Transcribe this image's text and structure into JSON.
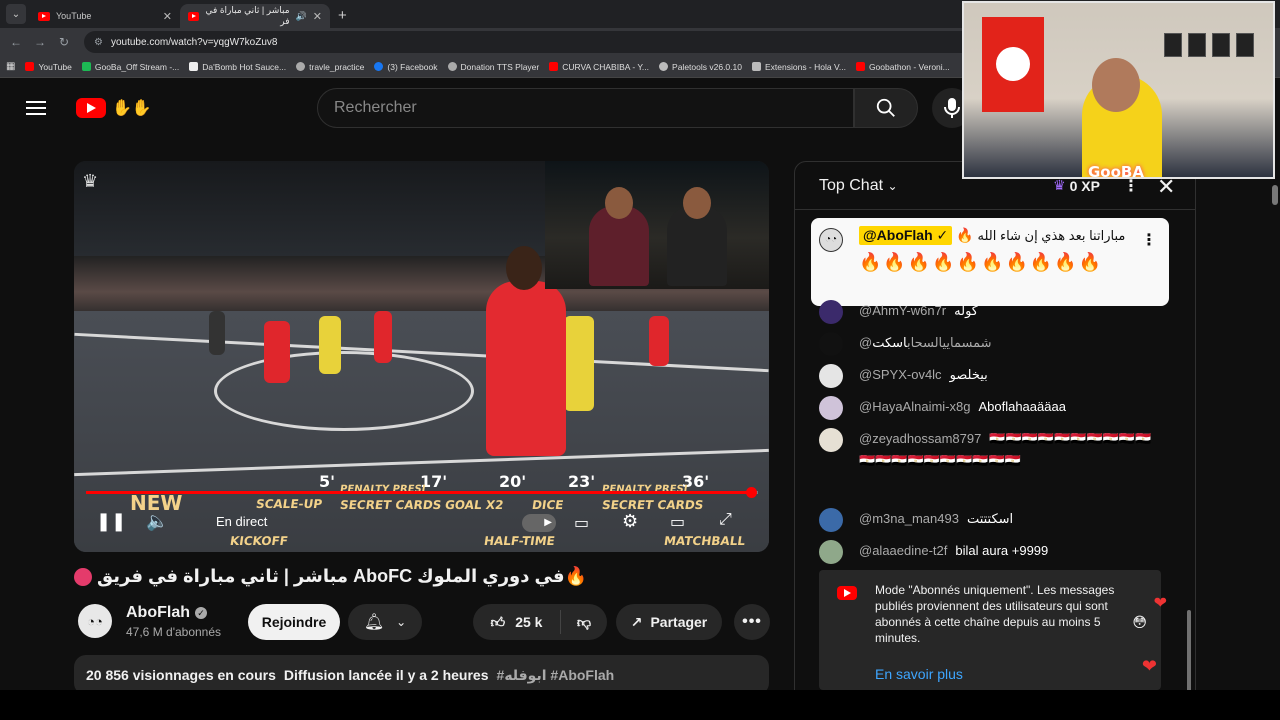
{
  "browser": {
    "tabs": [
      {
        "title": "YouTube",
        "active": false
      },
      {
        "title": "مباشر | ثاني مباراة في فر",
        "active": true
      }
    ],
    "url": "youtube.com/watch?v=yqgW7koZuv8",
    "bookmarks": [
      {
        "label": "YouTube",
        "color": "#ff0000"
      },
      {
        "label": "GooBa_Off Stream -...",
        "color": "#1db954"
      },
      {
        "label": "Da'Bomb Hot Sauce...",
        "color": "#eeeeee"
      },
      {
        "label": "travle_practice",
        "color": "#aaaaaa"
      },
      {
        "label": "(3) Facebook",
        "color": "#1877f2"
      },
      {
        "label": "Donation TTS Player",
        "color": "#aaaaaa"
      },
      {
        "label": "CURVA CHABIBA - Y...",
        "color": "#ff0000"
      },
      {
        "label": "Paletools v26.0.10",
        "color": "#bbbbbb"
      },
      {
        "label": "Extensions - Hola V...",
        "color": "#bbbbbb"
      },
      {
        "label": "Goobathon - Veroni...",
        "color": "#ff0000"
      }
    ]
  },
  "header": {
    "search_placeholder": "Rechercher"
  },
  "video": {
    "live_label": "En direct",
    "timeline_minutes": [
      "5'",
      "17'",
      "20'",
      "23'",
      "36'"
    ],
    "timeline_labels": [
      "SCALE-UP",
      "PENALTY PRESI",
      "SECRET CARDS",
      "GOAL X2",
      "DICE",
      "PENALTY PRESI",
      "SECRET CARDS",
      "KICKOFF",
      "HALF-TIME",
      "MATCHBALL"
    ],
    "progress_fraction": 0.99,
    "title": "في دوري الملوك AboFC مباشر | ثاني مباراة في فريق",
    "channel": "AboFlah",
    "subscribers": "47,6 M d'abonnés",
    "join_label": "Rejoindre",
    "likes": "25 k",
    "share_label": "Partager",
    "views": "20 856 visionnages en cours",
    "started": "Diffusion lancée il y a 2 heures",
    "tags": "#ابوفله #AboFlah"
  },
  "chat": {
    "title": "Top Chat",
    "xp": "0 XP",
    "pinned": {
      "author": "@AboFlah",
      "message": "مباراتنا بعد هذي إن شاء الله",
      "emojis": "🔥🔥🔥🔥🔥🔥🔥🔥🔥🔥"
    },
    "messages": [
      {
        "author": "@AhmY-w6n7r",
        "text": "كوله",
        "avatar_color": "#3b2a6b"
      },
      {
        "author": "@شمسماييالسحاب",
        "text": "اسكت",
        "avatar_color": "#111111"
      },
      {
        "author": "@SPYX-ov4lc",
        "text": "بيخلصو",
        "avatar_color": "#e5e5e5"
      },
      {
        "author": "@HayaAlnaimi-x8g",
        "text": "Aboflahaaääaa",
        "avatar_color": "#cfc3d9"
      },
      {
        "author": "@zeyadhossam8797",
        "text": "🇪🇬🇪🇬🇪🇬🇪🇬🇪🇬🇪🇬🇪🇬🇪🇬🇪🇬🇪🇬🇪🇬🇪🇬🇪🇬🇪🇬🇪🇬🇪🇬🇪🇬🇪🇬🇪🇬🇪🇬",
        "avatar_color": "#e6e0d4"
      },
      {
        "author": "@m3na_man493",
        "text": "اسكتتتت",
        "avatar_color": "#3b6aa8"
      },
      {
        "author": "@alaaedine-t2f",
        "text": "bilal aura +9999",
        "avatar_color": "#8fa88a"
      }
    ],
    "notice_text": "Mode \"Abonnés uniquement\". Les messages publiés proviennent des utilisateurs qui sont abonnés à cette chaîne depuis au moins 5 minutes.",
    "notice_link": "En savoir plus"
  },
  "webcam": {
    "overlay_text": "GooBA"
  }
}
